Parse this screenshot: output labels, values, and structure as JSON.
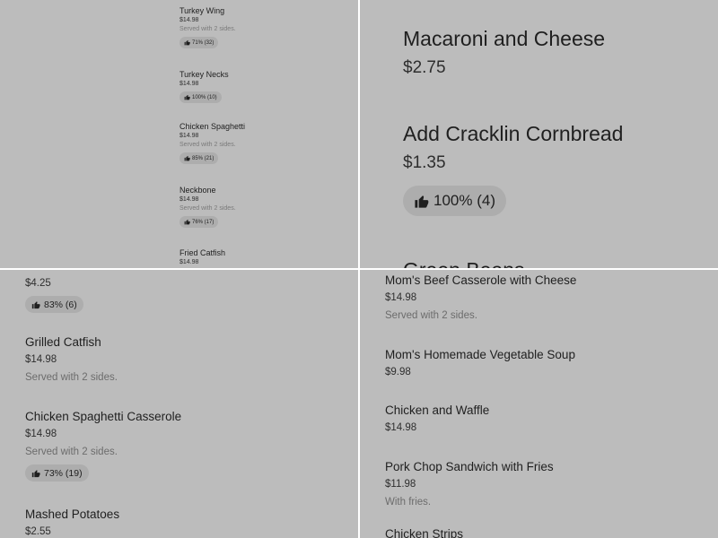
{
  "tiles": {
    "top_left": {
      "items": [
        {
          "name": "Turkey Wing",
          "price": "$14.98",
          "desc": "Served with 2 sides.",
          "rating": "71% (32)"
        },
        {
          "name": "Turkey Necks",
          "price": "$14.98",
          "rating": "100% (10)"
        },
        {
          "name": "Chicken Spaghetti",
          "price": "$14.98",
          "desc": "Served with 2 sides.",
          "rating": "85% (21)"
        },
        {
          "name": "Neckbone",
          "price": "$14.98",
          "desc": "Served with 2 sides.",
          "rating": "76% (17)"
        },
        {
          "name": "Fried Catfish",
          "price": "$14.98"
        }
      ]
    },
    "top_right": {
      "items": [
        {
          "name": "Macaroni and Cheese",
          "price": "$2.75"
        },
        {
          "name": "Add Cracklin Cornbread",
          "price": "$1.35",
          "rating": "100% (4)"
        },
        {
          "name": "Green Beans"
        }
      ]
    },
    "bottom_left": {
      "items": [
        {
          "price": "$4.25",
          "rating": "83% (6)"
        },
        {
          "name": "Grilled Catfish",
          "price": "$14.98",
          "desc": "Served with 2 sides."
        },
        {
          "name": "Chicken Spaghetti Casserole",
          "price": "$14.98",
          "desc": "Served with 2 sides.",
          "rating": "73% (19)"
        },
        {
          "name": "Mashed Potatoes",
          "price": "$2.55"
        }
      ]
    },
    "bottom_right": {
      "items": [
        {
          "name": "Mom's Beef Casserole with Cheese",
          "price": "$14.98",
          "desc": "Served with 2 sides."
        },
        {
          "name": "Mom's Homemade Vegetable Soup",
          "price": "$9.98"
        },
        {
          "name": "Chicken and Waffle",
          "price": "$14.98"
        },
        {
          "name": "Pork Chop Sandwich with Fries",
          "price": "$11.98",
          "desc": "With fries."
        },
        {
          "name": "Chicken Strips"
        }
      ]
    }
  },
  "icons": {
    "rating": "thumbs-up-icon"
  },
  "colors": {
    "tile_bg": "#bcbcbc",
    "badge_bg": "#adadad",
    "text": "#1f1f1f",
    "muted": "#6c6c6c",
    "divider": "#ffffff"
  }
}
